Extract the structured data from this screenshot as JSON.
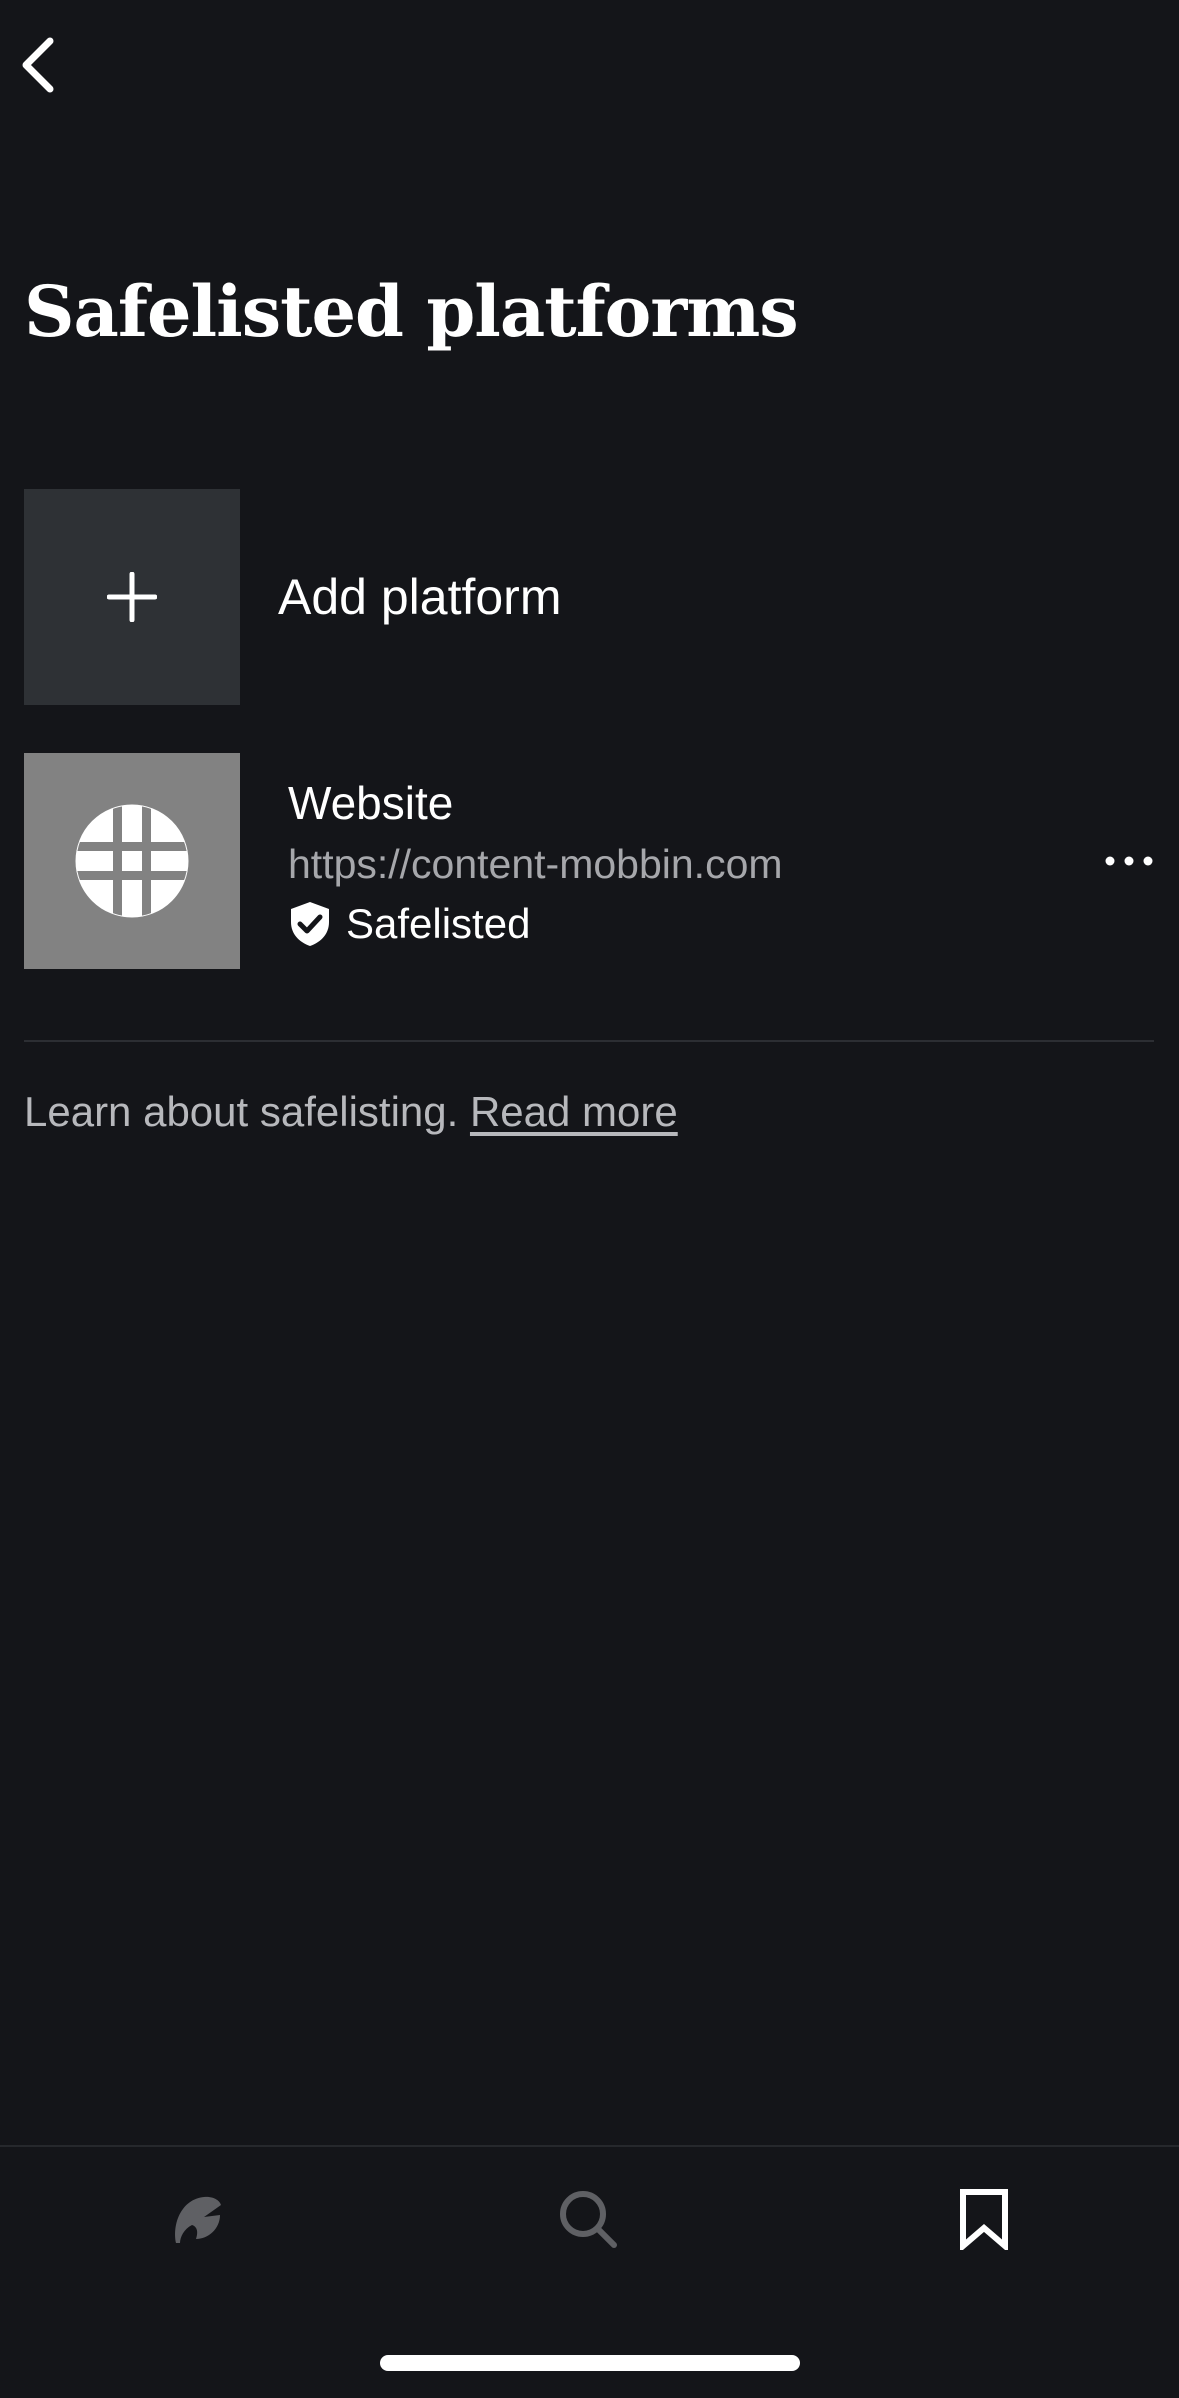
{
  "header": {
    "back_icon": "chevron-left-icon",
    "title": "Safelisted platforms"
  },
  "add_platform": {
    "icon": "plus-icon",
    "label": "Add platform"
  },
  "platforms": [
    {
      "icon": "globe-icon",
      "name": "Website",
      "url": "https://content-mobbin.com",
      "status_icon": "shield-check-icon",
      "status": "Safelisted",
      "menu_icon": "more-horizontal-icon"
    }
  ],
  "footer_note": {
    "text": "Learn about safelisting.",
    "link": "Read more"
  },
  "tab_bar": {
    "tabs": [
      {
        "icon": "logo-home-icon",
        "active": false
      },
      {
        "icon": "search-icon",
        "active": false
      },
      {
        "icon": "bookmark-icon",
        "active": true
      }
    ]
  },
  "colors": {
    "background": "#141519",
    "tile_add": "#2e3135",
    "tile_platform": "#828282",
    "text_primary": "#ffffff",
    "text_secondary": "#a6a7ab",
    "tab_inactive": "#5f6064"
  }
}
